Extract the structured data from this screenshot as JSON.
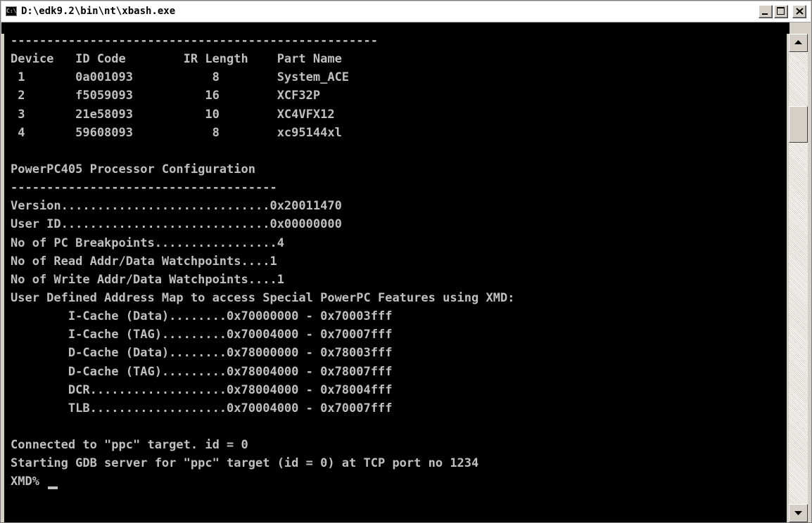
{
  "window": {
    "icon_text": "C:\\",
    "title": "D:\\edk9.2\\bin\\nt\\xbash.exe"
  },
  "console": {
    "lines": [
      "---------------------------------------------------",
      "Device   ID Code        IR Length    Part Name",
      " 1       0a001093           8        System_ACE",
      " 2       f5059093          16        XCF32P",
      " 3       21e58093          10        XC4VFX12",
      " 4       59608093           8        xc95144xl",
      "",
      "PowerPC405 Processor Configuration",
      "-------------------------------------",
      "Version.............................0x20011470",
      "User ID.............................0x00000000",
      "No of PC Breakpoints.................4",
      "No of Read Addr/Data Watchpoints....1",
      "No of Write Addr/Data Watchpoints....1",
      "User Defined Address Map to access Special PowerPC Features using XMD:",
      "        I-Cache (Data)........0x70000000 - 0x70003fff",
      "        I-Cache (TAG).........0x70004000 - 0x70007fff",
      "        D-Cache (Data)........0x78000000 - 0x78003fff",
      "        D-Cache (TAG).........0x78004000 - 0x78007fff",
      "        DCR...................0x78004000 - 0x78004fff",
      "        TLB...................0x70004000 - 0x70007fff",
      "",
      "Connected to \"ppc\" target. id = 0",
      "Starting GDB server for \"ppc\" target (id = 0) at TCP port no 1234"
    ],
    "prompt": "XMD% "
  },
  "colors": {
    "console_bg": "#000000",
    "console_fg": "#c0c0c0"
  }
}
